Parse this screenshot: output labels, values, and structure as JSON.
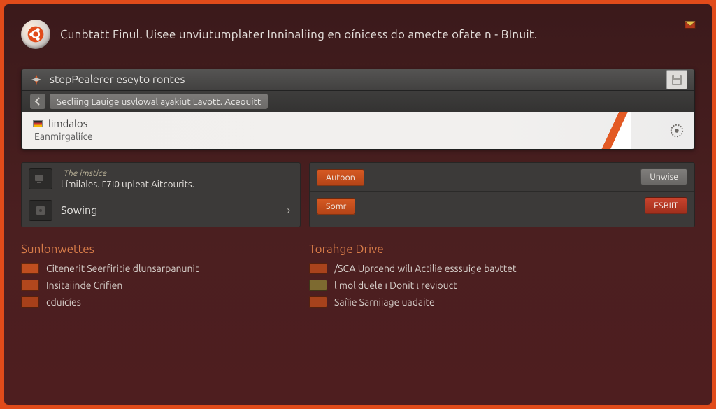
{
  "header": {
    "title": "Cunbtatt Finul. Uisee unviutumplater Inninaliing en oínicess do amecte ofate n - BInuit."
  },
  "step_panel": {
    "title": "stepPealerer eseyto rontes",
    "breadcrumb_chip": "Secliing Lauige usvlowal ayakiut Lavott. Aceouitt",
    "white_title": "limdalos",
    "white_subtitle": "Eanmirgaliíce"
  },
  "dark_panel": {
    "left": {
      "hint": "The imstice",
      "line": "l ímilales. Г7I0 upleat Aitcourits.",
      "row2_label": "Sowing"
    },
    "right": {
      "btn1": "Autoon",
      "btn2": "Unwise",
      "btn3": "Somr",
      "btn4": "ESBIIT"
    }
  },
  "links": {
    "left_title": "Sunlonwettes",
    "left_items": [
      "Citenerit Seerfiritie dlunsarpanunit",
      "Insitaiinde Crifien",
      "cduicíes"
    ],
    "right_title": "Torahge Drive",
    "right_items": [
      "/SCA Uprcend wiľı Actilie esssuige bavttet",
      "l mol duele ı Donit ι reviouct",
      "Saíïie Sarniiage uadaite"
    ]
  }
}
